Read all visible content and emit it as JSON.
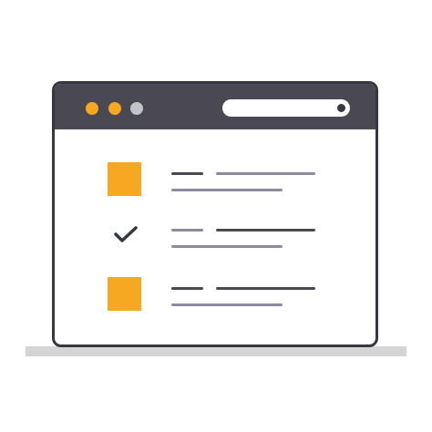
{
  "window": {
    "titlebar": {
      "traffic_lights": [
        {
          "color": "#f7a822"
        },
        {
          "color": "#f7a822"
        },
        {
          "color": "#c3c3ca"
        }
      ],
      "address_bar": {
        "placeholder": ""
      }
    },
    "list": [
      {
        "marker": "square",
        "marker_color": "#f7a822"
      },
      {
        "marker": "check-icon",
        "marker_color": "#373741"
      },
      {
        "marker": "square",
        "marker_color": "#f7a822"
      }
    ]
  },
  "colors": {
    "frame": "#373741",
    "titlebar": "#494853",
    "accent": "#f7a822",
    "line_dark": "#494853",
    "line_gray": "#8b8aa0",
    "shadow": "#d5d5d5"
  }
}
